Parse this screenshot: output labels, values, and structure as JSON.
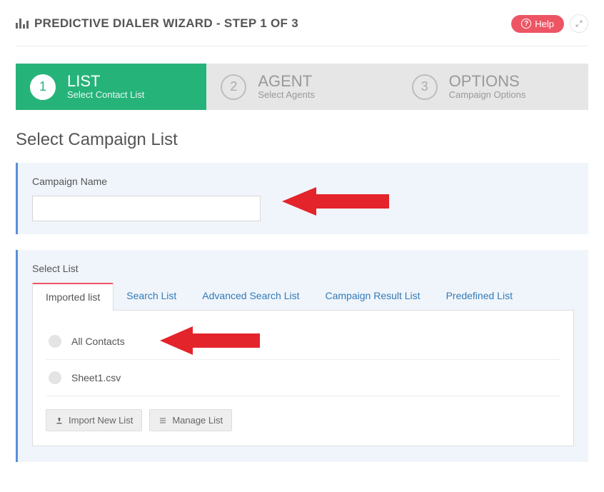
{
  "header": {
    "title": "PREDICTIVE DIALER WIZARD - STEP 1 OF 3",
    "help_label": "Help"
  },
  "steps": [
    {
      "num": "1",
      "title": "LIST",
      "sub": "Select Contact List",
      "active": true
    },
    {
      "num": "2",
      "title": "AGENT",
      "sub": "Select Agents",
      "active": false
    },
    {
      "num": "3",
      "title": "OPTIONS",
      "sub": "Campaign Options",
      "active": false
    }
  ],
  "section_heading": "Select Campaign List",
  "campaign_panel": {
    "label": "Campaign Name",
    "value": ""
  },
  "list_panel": {
    "label": "Select List",
    "tabs": [
      {
        "label": "Imported list",
        "active": true
      },
      {
        "label": "Search List",
        "active": false
      },
      {
        "label": "Advanced Search List",
        "active": false
      },
      {
        "label": "Campaign Result List",
        "active": false
      },
      {
        "label": "Predefined List",
        "active": false
      }
    ],
    "items": [
      {
        "label": "All Contacts"
      },
      {
        "label": "Sheet1.csv"
      }
    ],
    "import_btn": "Import New List",
    "manage_btn": "Manage List"
  },
  "annotations": {
    "arrow_color": "#e3242b"
  }
}
